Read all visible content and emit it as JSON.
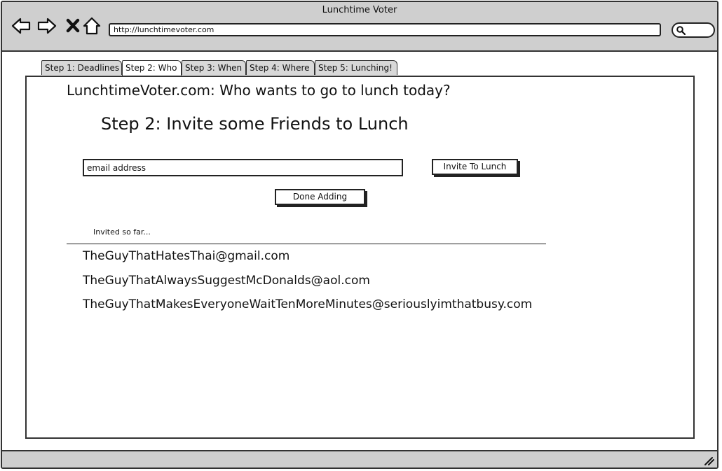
{
  "window": {
    "title": "Lunchtime Voter"
  },
  "toolbar": {
    "back_icon": "back-arrow-icon",
    "forward_icon": "forward-arrow-icon",
    "stop_icon": "close-icon",
    "home_icon": "home-icon",
    "url": "http://lunchtimevoter.com",
    "search_icon": "search-icon"
  },
  "tabs": [
    {
      "label": "Step 1: Deadlines"
    },
    {
      "label": "Step 2: Who"
    },
    {
      "label": "Step 3: When"
    },
    {
      "label": "Step 4: Where"
    },
    {
      "label": "Step 5: Lunching!"
    }
  ],
  "main": {
    "site_heading": "LunchtimeVoter.com:  Who wants to go to lunch today?",
    "step_heading": "Step 2: Invite some Friends to Lunch",
    "email_placeholder": "email address",
    "invite_button": "Invite To Lunch",
    "done_button": "Done Adding",
    "invited_label": "Invited so far...",
    "invited": [
      "TheGuyThatHatesThai@gmail.com",
      "TheGuyThatAlwaysSuggestMcDonalds@aol.com",
      "TheGuyThatMakesEveryoneWaitTenMoreMinutes@seriouslyimthatbusy.com"
    ]
  },
  "colors": {
    "chrome": "#cfcfcf",
    "border": "#333333",
    "background": "#ffffff"
  }
}
